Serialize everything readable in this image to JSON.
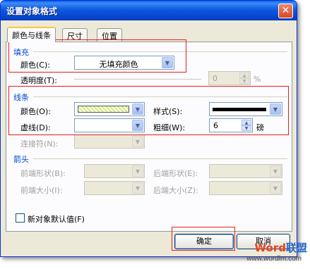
{
  "window": {
    "title": "设置对象格式",
    "close_glyph": "✕"
  },
  "tabs": [
    {
      "label": "颜色与线条",
      "active": true
    },
    {
      "label": "尺寸",
      "active": false
    },
    {
      "label": "位置",
      "active": false
    }
  ],
  "fill": {
    "heading": "填充",
    "color_label": "颜色(C):",
    "color_value": "无填充颜色",
    "transparency_label": "透明度(T):",
    "transparency_value": "0",
    "percent_sign": "%"
  },
  "line": {
    "heading": "线条",
    "color_label": "颜色(O):",
    "style_label": "样式(S):",
    "dashed_label": "虚线(D):",
    "weight_label": "粗细(W):",
    "weight_value": "6",
    "weight_unit": "磅",
    "connector_label": "连接符(N):",
    "line_color_swatch": "#d7e87a"
  },
  "arrows": {
    "heading": "箭头",
    "begin_style_label": "前端形状(B):",
    "end_style_label": "后端形状(E):",
    "begin_size_label": "前端大小(I):",
    "end_size_label": "后端大小(Z):"
  },
  "defaults_checkbox": {
    "label": "新对象默认值(F)",
    "checked": false
  },
  "buttons": {
    "ok": "确定",
    "cancel": "取消"
  },
  "watermark": {
    "logo_part1": "Word",
    "logo_part2": "联盟",
    "url": "www.wordlm.com"
  },
  "colors": {
    "title_bar": "#0a5fe6",
    "group_heading": "#0046d5",
    "annotation": "#e51d1d",
    "dialog_bg": "#ece9d8"
  }
}
